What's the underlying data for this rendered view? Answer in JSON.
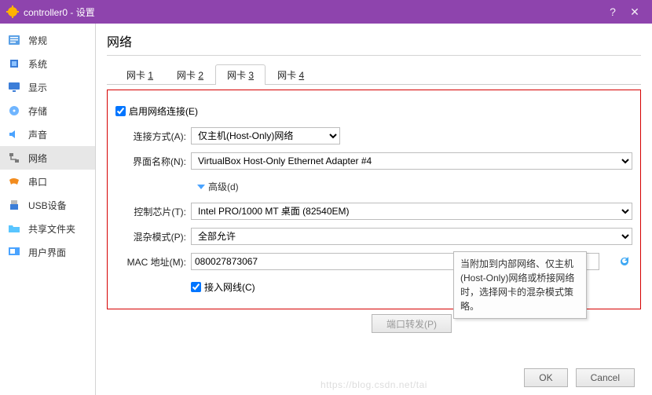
{
  "window": {
    "title": "controller0 - 设置"
  },
  "sidebar": {
    "items": [
      {
        "label": "常规",
        "icon": "list"
      },
      {
        "label": "系统",
        "icon": "chip"
      },
      {
        "label": "显示",
        "icon": "monitor"
      },
      {
        "label": "存储",
        "icon": "disk"
      },
      {
        "label": "声音",
        "icon": "speaker"
      },
      {
        "label": "网络",
        "icon": "net",
        "selected": true
      },
      {
        "label": "串口",
        "icon": "serial"
      },
      {
        "label": "USB设备",
        "icon": "usb"
      },
      {
        "label": "共享文件夹",
        "icon": "folder"
      },
      {
        "label": "用户界面",
        "icon": "ui"
      }
    ]
  },
  "page": {
    "title": "网络"
  },
  "tabs": [
    {
      "label": "网卡 ",
      "key": "1"
    },
    {
      "label": "网卡 ",
      "key": "2"
    },
    {
      "label": "网卡 ",
      "key": "3",
      "active": true
    },
    {
      "label": "网卡 ",
      "key": "4"
    }
  ],
  "form": {
    "enable_label": "启用网络连接(E)",
    "enable_checked": true,
    "attach_label": "连接方式(A):",
    "attach_value": "仅主机(Host-Only)网络",
    "name_label": "界面名称(N):",
    "name_value": "VirtualBox Host-Only Ethernet Adapter #4",
    "advanced_label": "高级(d)",
    "adapter_label": "控制芯片(T):",
    "adapter_value": "Intel PRO/1000 MT 桌面 (82540EM)",
    "promisc_label": "混杂模式(P):",
    "promisc_value": "全部允许",
    "mac_label": "MAC 地址(M):",
    "mac_value": "080027873067",
    "cable_label": "接入网线(C)",
    "cable_checked": true,
    "pf_label": "端口转发(P)"
  },
  "tooltip": "当附加到内部网络、仅主机(Host-Only)网络或桥接网络时，选择网卡的混杂模式策略。",
  "buttons": {
    "ok": "OK",
    "cancel": "Cancel"
  },
  "watermark": "https://blog.csdn.net/tai"
}
